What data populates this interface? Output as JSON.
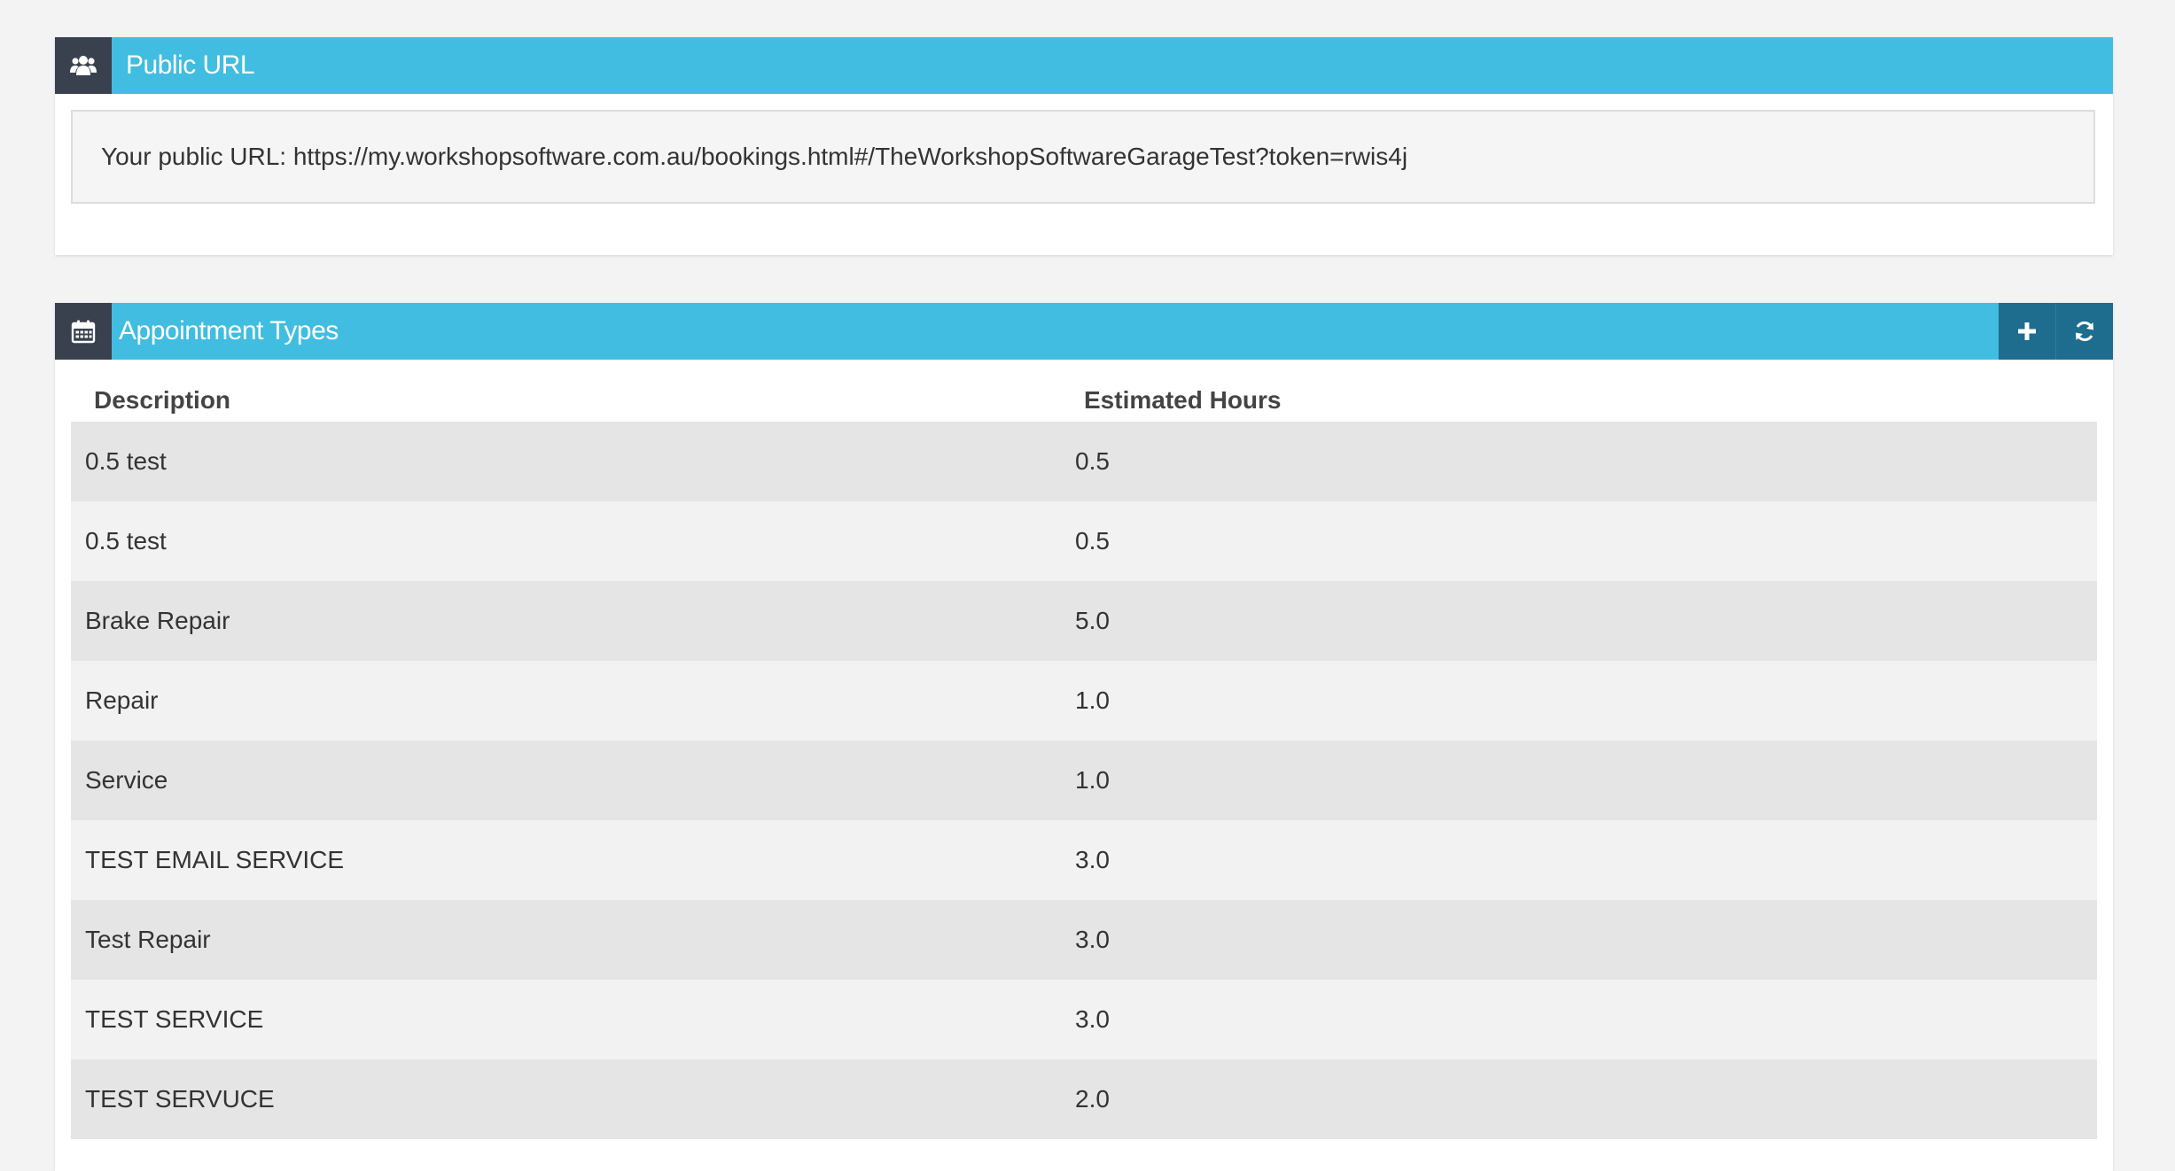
{
  "public_url_panel": {
    "title": "Public URL",
    "icon": "users-icon",
    "url_text": "Your public URL: https://my.workshopsoftware.com.au/bookings.html#/TheWorkshopSoftwareGarageTest?token=rwis4j"
  },
  "appointment_types_panel": {
    "title": "Appointment Types",
    "icon": "calendar-icon",
    "actions": {
      "add_icon": "plus-icon",
      "refresh_icon": "refresh-icon"
    },
    "columns": [
      "Description",
      "Estimated Hours"
    ],
    "rows": [
      {
        "description": "0.5 test",
        "hours": "0.5"
      },
      {
        "description": "0.5 test",
        "hours": "0.5"
      },
      {
        "description": "Brake Repair",
        "hours": "5.0"
      },
      {
        "description": "Repair",
        "hours": "1.0"
      },
      {
        "description": "Service",
        "hours": "1.0"
      },
      {
        "description": "TEST EMAIL SERVICE",
        "hours": "3.0"
      },
      {
        "description": "Test Repair",
        "hours": "3.0"
      },
      {
        "description": "TEST SERVICE",
        "hours": "3.0"
      },
      {
        "description": "TEST SERVUCE",
        "hours": "2.0"
      }
    ]
  },
  "colors": {
    "header_bar": "#40bde0",
    "icon_box": "#39404e",
    "action_button": "#1e6c8e",
    "page_background": "#f3f3f3"
  }
}
